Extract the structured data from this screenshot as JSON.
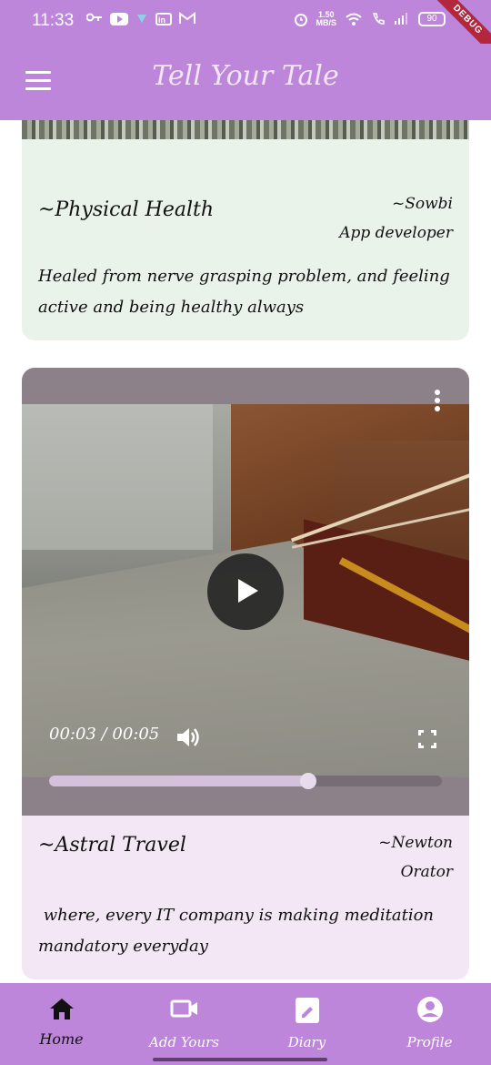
{
  "status_bar": {
    "time": "11:33",
    "speed_value": "1.50",
    "speed_unit": "MB/S",
    "battery": "90",
    "debug_banner": "DEBUG"
  },
  "app_bar": {
    "title": "Tell Your Tale",
    "menu_icon": "hamburger-menu-icon"
  },
  "posts": [
    {
      "title": "~Physical Health",
      "author": "~Sowbi",
      "role": "App developer",
      "body": "Healed from nerve grasping problem, and feeling active and being healthy always",
      "background": "#eaf3ea"
    },
    {
      "title": "~Astral Travel",
      "author": "~Newton",
      "role": "Orator",
      "body": " where, every IT company is making meditation mandatory everyday",
      "background": "#f3e6f5",
      "video": {
        "time_display": "00:03 / 00:05",
        "progress": 0.66,
        "state": "paused"
      }
    }
  ],
  "bottom_nav": {
    "items": [
      {
        "label": "Home",
        "icon": "home-icon",
        "active": true
      },
      {
        "label": "Add Yours",
        "icon": "video-camera-icon",
        "active": false
      },
      {
        "label": "Diary",
        "icon": "clipboard-edit-icon",
        "active": false
      },
      {
        "label": "Profile",
        "icon": "account-circle-icon",
        "active": false
      }
    ]
  },
  "colors": {
    "accent": "#bd86da",
    "card_green": "#eaf3ea",
    "card_purple": "#f3e6f5"
  }
}
